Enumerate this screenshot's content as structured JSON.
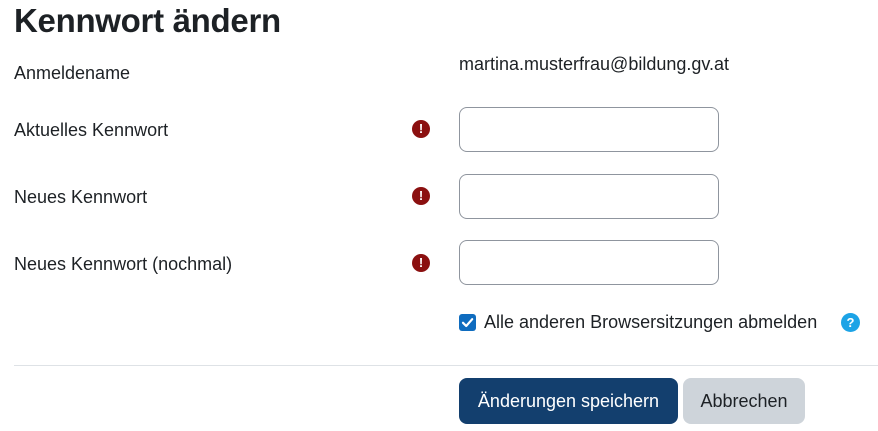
{
  "page": {
    "title": "Kennwort ändern"
  },
  "form": {
    "username": {
      "label": "Anmeldename",
      "value": "martina.musterfrau@bildung.gv.at"
    },
    "current_password": {
      "label": "Aktuelles Kennwort",
      "value": "",
      "required_icon": "exclamation-circle-icon"
    },
    "new_password": {
      "label": "Neues Kennwort",
      "value": "",
      "required_icon": "exclamation-circle-icon"
    },
    "new_password_repeat": {
      "label": "Neues Kennwort (nochmal)",
      "value": "",
      "required_icon": "exclamation-circle-icon"
    },
    "logout_other_sessions": {
      "label": "Alle anderen Browsersitzungen abmelden",
      "checked": true,
      "help_icon": "question-circle-icon"
    }
  },
  "actions": {
    "save_label": "Änderungen speichern",
    "cancel_label": "Abbrechen"
  },
  "colors": {
    "required": "#8b1010",
    "help": "#1ca3e6",
    "primary_button": "#133f6e",
    "secondary_button": "#ced4da",
    "checkbox": "#0f6cbf"
  }
}
